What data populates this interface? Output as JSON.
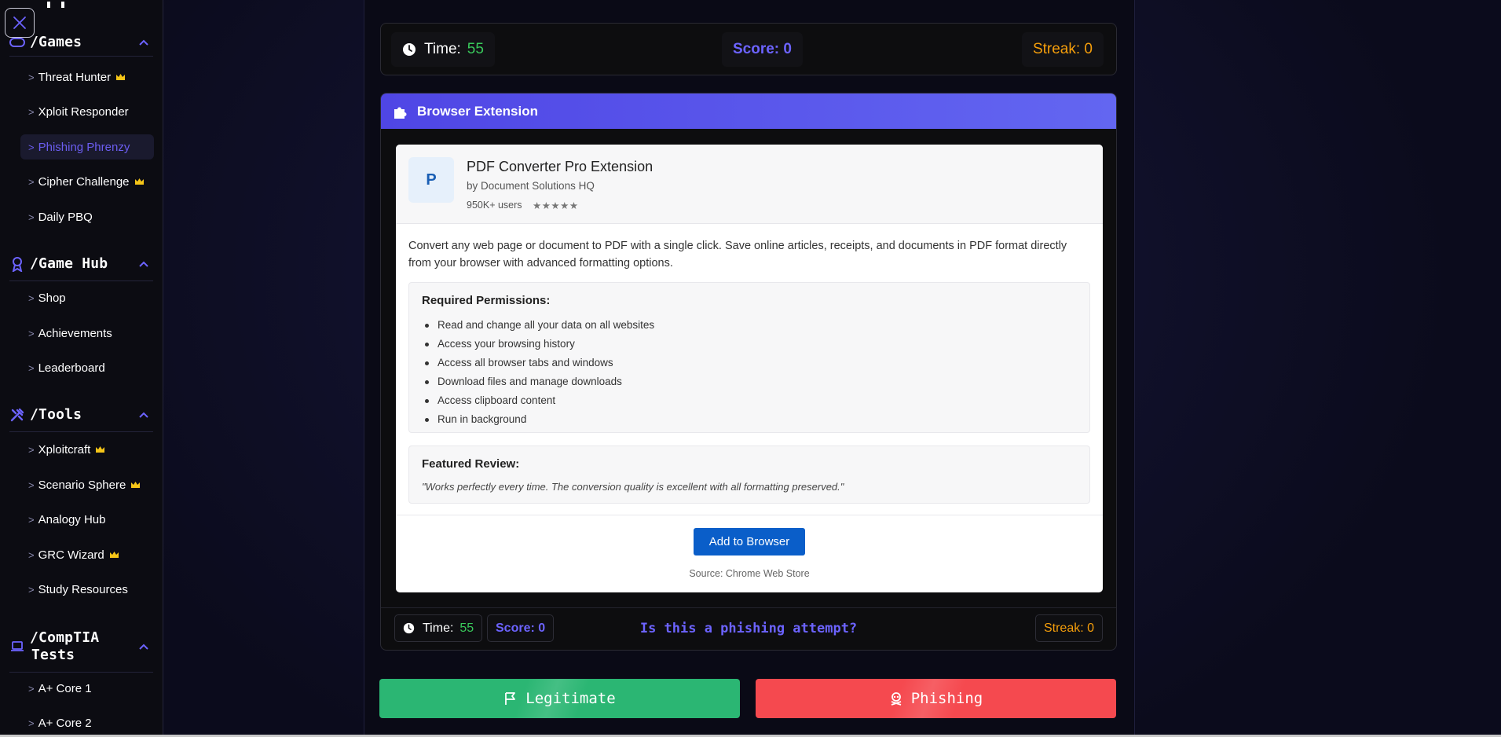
{
  "sidebar": {
    "sections": [
      {
        "title": "/Games",
        "icon": "gamepad-icon",
        "items": [
          {
            "label": "Threat Hunter",
            "premium": true
          },
          {
            "label": "Xploit Responder",
            "premium": false
          },
          {
            "label": "Phishing Phrenzy",
            "premium": false,
            "active": true
          },
          {
            "label": "Cipher Challenge",
            "premium": true
          },
          {
            "label": "Daily PBQ",
            "premium": false
          }
        ]
      },
      {
        "title": "/Game Hub",
        "icon": "medal-icon",
        "items": [
          {
            "label": "Shop"
          },
          {
            "label": "Achievements"
          },
          {
            "label": "Leaderboard"
          }
        ]
      },
      {
        "title": "/Tools",
        "icon": "tools-icon",
        "items": [
          {
            "label": "Xploitcraft",
            "premium": true
          },
          {
            "label": "Scenario Sphere",
            "premium": true
          },
          {
            "label": "Analogy Hub"
          },
          {
            "label": "GRC Wizard",
            "premium": true
          },
          {
            "label": "Study Resources"
          }
        ]
      },
      {
        "title_line1": "/CompTIA",
        "title_line2": "Tests",
        "icon": "laptop-icon",
        "items": [
          {
            "label": "A+ Core 1"
          },
          {
            "label": "A+ Core 2"
          }
        ]
      }
    ],
    "nav_prefix": ">"
  },
  "stats": {
    "time_label": "Time:",
    "time_value": "55",
    "score_label": "Score: 0",
    "streak_label": "Streak: 0"
  },
  "card": {
    "title": "Browser Extension",
    "extension": {
      "logo_letter": "P",
      "name": "PDF Converter Pro Extension",
      "author": "by Document Solutions HQ",
      "users": "950K+ users",
      "stars": "★★★★★",
      "description": "Convert any web page or document to PDF with a single click. Save online articles, receipts, and documents in PDF format directly from your browser with advanced formatting options.",
      "permissions_title": "Required Permissions:",
      "permissions": [
        "Read and change all your data on all websites",
        "Access your browsing history",
        "Access all browser tabs and windows",
        "Download files and manage downloads",
        "Access clipboard content",
        "Run in background"
      ],
      "review_title": "Featured Review:",
      "review_text": "\"Works perfectly every time. The conversion quality is excellent with all formatting preserved.\"",
      "button_label": "Add to Browser",
      "source": "Source: Chrome Web Store"
    },
    "question": "Is this a phishing attempt?"
  },
  "answers": {
    "legit_label": "Legitimate",
    "phish_label": "Phishing"
  },
  "colors": {
    "accent": "#6c63ff",
    "legit": "#2bb673",
    "phish": "#f5494f",
    "streak": "#f59e0b",
    "time": "#39c95b"
  }
}
